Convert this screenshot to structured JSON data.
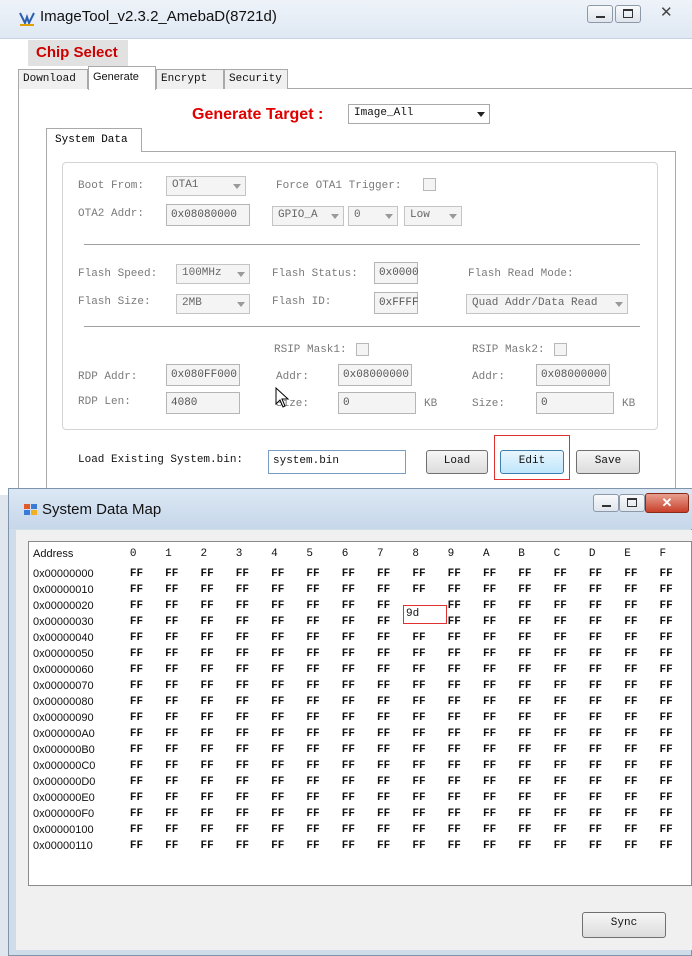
{
  "main_window": {
    "title": "ImageTool_v2.3.2_AmebaD(8721d)",
    "chip_select": "Chip Select",
    "tabs": [
      "Download",
      "Generate",
      "Encrypt",
      "Security"
    ],
    "active_tab": "Generate",
    "generate_target_label": "Generate Target :",
    "generate_target_value": "Image_All",
    "system_data_tab": "System Data",
    "boot_from_label": "Boot From:",
    "boot_from_value": "OTA1",
    "force_ota1_label": "Force OTA1 Trigger:",
    "ota2_addr_label": "OTA2 Addr:",
    "ota2_addr_value": "0x08080000",
    "gpio_value": "GPIO_A",
    "pin_value": "0",
    "level_value": "Low",
    "flash_speed_label": "Flash Speed:",
    "flash_speed_value": "100MHz",
    "flash_status_label": "Flash Status:",
    "flash_status_value": "0x0000",
    "flash_read_mode_label": "Flash Read Mode:",
    "flash_read_mode_value": "Quad Addr/Data Read",
    "flash_size_label": "Flash Size:",
    "flash_size_value": "2MB",
    "flash_id_label": "Flash ID:",
    "flash_id_value": "0xFFFF",
    "rsip_mask1_label": "RSIP Mask1:",
    "rsip_mask2_label": "RSIP Mask2:",
    "rdp_addr_label": "RDP Addr:",
    "rdp_addr_value": "0x080FF000",
    "mask1_addr_label": "Addr:",
    "mask1_addr_value": "0x08000000",
    "mask2_addr_label": "Addr:",
    "mask2_addr_value": "0x08000000",
    "rdp_len_label": "RDP Len:",
    "rdp_len_value": "4080",
    "mask1_size_label": "Size:",
    "mask1_size_value": "0",
    "mask1_unit": "KB",
    "mask2_size_label": "Size:",
    "mask2_size_value": "0",
    "mask2_unit": "KB",
    "load_existing_label": "Load Existing System.bin:",
    "system_bin_value": "system.bin",
    "load_button": "Load",
    "edit_button": "Edit",
    "save_button": "Save"
  },
  "map_window": {
    "title": "System Data Map",
    "columns": [
      "Address",
      "0",
      "1",
      "2",
      "3",
      "4",
      "5",
      "6",
      "7",
      "8",
      "9",
      "A",
      "B",
      "C",
      "D",
      "E",
      "F"
    ],
    "addresses": [
      "0x00000000",
      "0x00000010",
      "0x00000020",
      "0x00000030",
      "0x00000040",
      "0x00000050",
      "0x00000060",
      "0x00000070",
      "0x00000080",
      "0x00000090",
      "0x000000A0",
      "0x000000B0",
      "0x000000C0",
      "0x000000D0",
      "0x000000E0",
      "0x000000F0",
      "0x00000100",
      "0x00000110"
    ],
    "fill_value": "FF",
    "editing_cell_value": "9d",
    "sync_button": "Sync"
  }
}
